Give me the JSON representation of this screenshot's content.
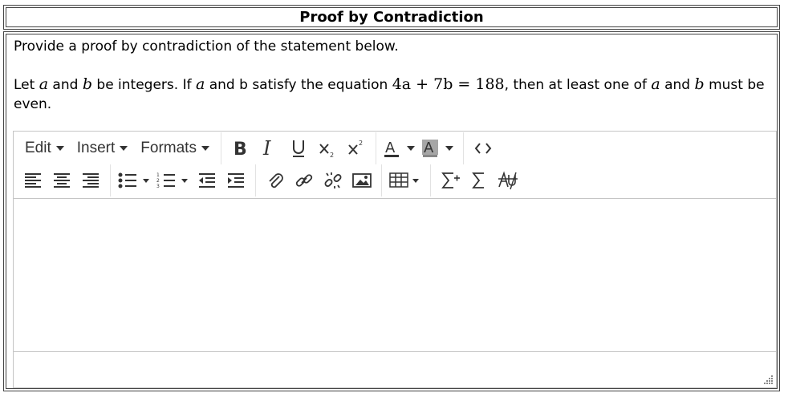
{
  "title": "Proof by Contradiction",
  "prompt": {
    "intro": "Provide a proof by contradiction of the statement below.",
    "s1": "Let ",
    "m_a1": "a",
    "s2": " and ",
    "m_b1": "b",
    "s3": " be integers. If ",
    "m_a2": "a",
    "s4": " and b satisfy the equation ",
    "m_eq": "4a + 7b = 188",
    "s5": ", then at least one of ",
    "m_a3": "a",
    "s6": " and ",
    "m_b2": "b",
    "s7": " must be even."
  },
  "editor": {
    "menus": [
      "Edit",
      "Insert",
      "Formats"
    ],
    "toolbar_icons_row1": [
      "bold-icon",
      "italic-icon",
      "underline-icon",
      "subscript-icon",
      "superscript-icon",
      "text-color-icon",
      "background-color-icon",
      "source-code-icon"
    ],
    "toolbar_icons_row2": [
      "align-left-icon",
      "align-center-icon",
      "align-right-icon",
      "bullet-list-icon",
      "numbered-list-icon",
      "outdent-icon",
      "indent-icon",
      "attachment-icon",
      "link-icon",
      "unlink-icon",
      "image-icon",
      "table-icon",
      "insert-equation-icon",
      "equation-icon",
      "strikethrough-script-icon"
    ],
    "colors": {
      "border": "#c5c5c5",
      "icon": "#333333",
      "background_highlight": "#a6a6a6"
    }
  }
}
